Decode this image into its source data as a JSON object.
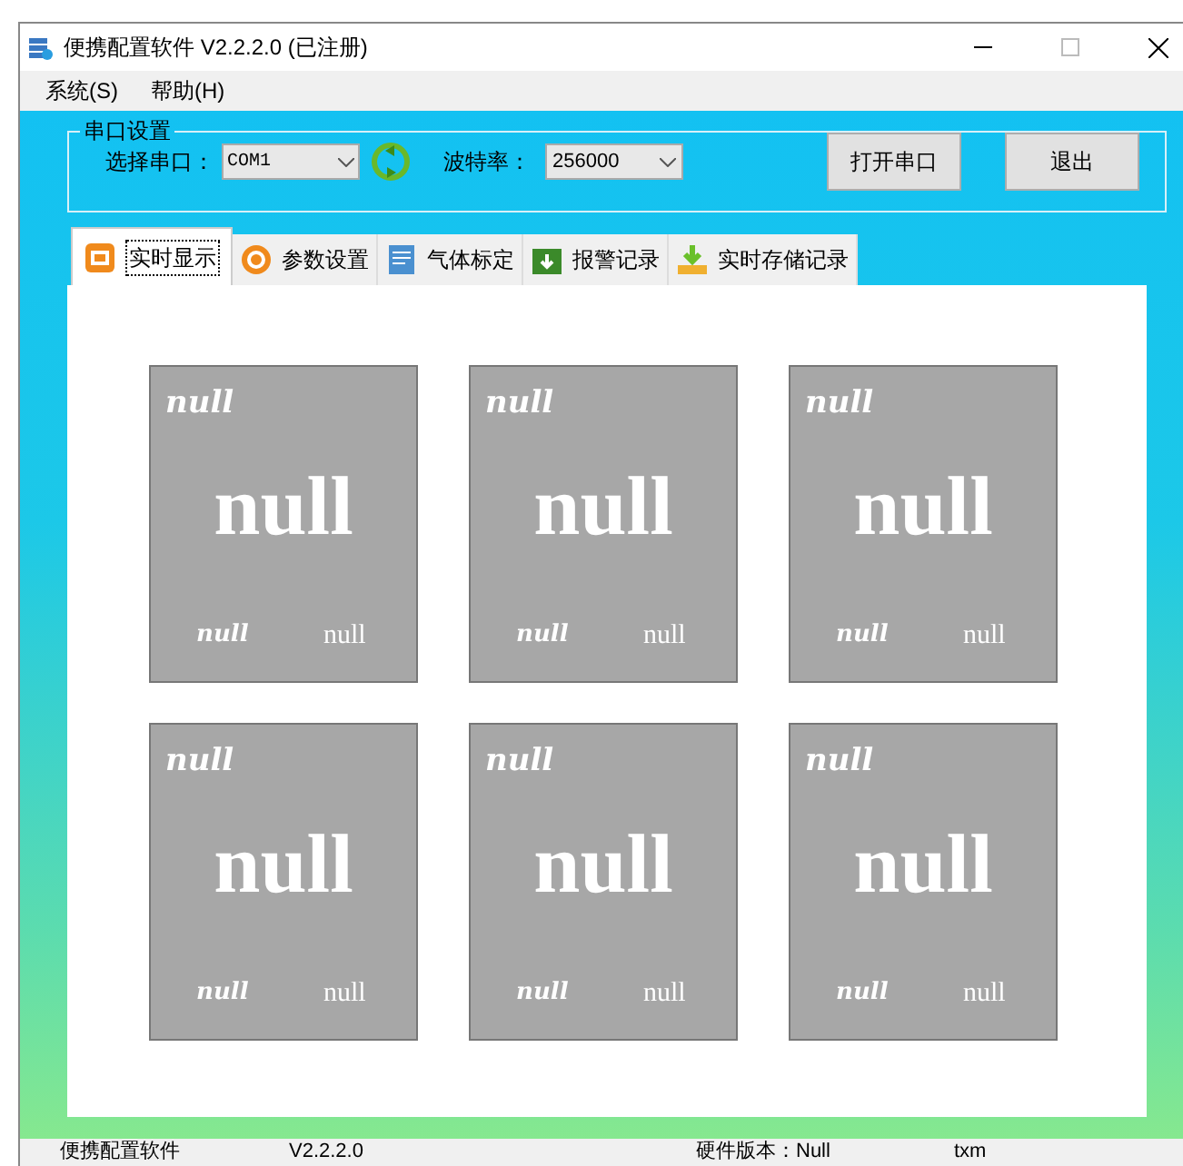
{
  "window": {
    "title": "便携配置软件 V2.2.2.0 (已注册)"
  },
  "menu": [
    "系统(S)",
    "帮助(H)"
  ],
  "serial_settings": {
    "title": "串口设置",
    "port_label": "选择串口：",
    "port": "COM1",
    "baud_label": "波特率：",
    "baud": "256000",
    "buttons": [
      "打开串口",
      "退出"
    ]
  },
  "tabs": [
    {
      "label": "实时显示",
      "selected": true,
      "kind": "display"
    },
    {
      "label": "参数设置",
      "selected": false,
      "kind": "params"
    },
    {
      "label": "气体标定",
      "selected": false,
      "kind": "calibrate"
    },
    {
      "label": "报警记录",
      "selected": false,
      "kind": "alarm"
    },
    {
      "label": "实时存储记录",
      "selected": false,
      "kind": "storage"
    }
  ],
  "cards": [
    {
      "name": "null",
      "value": "null",
      "left": "null",
      "right": "null"
    },
    {
      "name": "null",
      "value": "null",
      "left": "null",
      "right": "null"
    },
    {
      "name": "null",
      "value": "null",
      "left": "null",
      "right": "null"
    },
    {
      "name": "null",
      "value": "null",
      "left": "null",
      "right": "null"
    },
    {
      "name": "null",
      "value": "null",
      "left": "null",
      "right": "null"
    },
    {
      "name": "null",
      "value": "null",
      "left": "null",
      "right": "null"
    }
  ],
  "status_bar": [
    "便携配置软件",
    "V2.2.2.0",
    "硬件版本：Null",
    "txm"
  ]
}
